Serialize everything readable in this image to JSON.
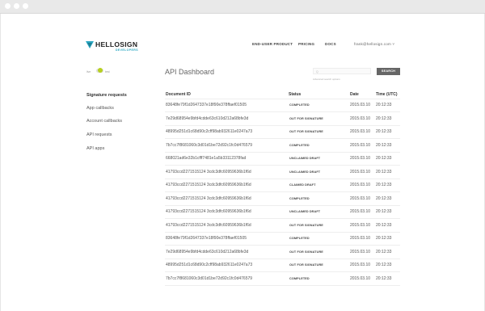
{
  "brand": {
    "name": "HELLOSIGN",
    "sub": "DEVELOPERS"
  },
  "nav": {
    "items": [
      "END-USER PRODUCT",
      "PRICING",
      "DOCS"
    ],
    "email": "frank@hellosign.com ˅"
  },
  "mode": {
    "left": "live",
    "right": "test"
  },
  "sidebar": {
    "heading": "Signature requests",
    "items": [
      "App callbacks",
      "Account callbacks",
      "API requests",
      "API apps"
    ]
  },
  "main": {
    "title": "API Dashboard",
    "search_placeholder": "Q",
    "search_hint": "Advanced search options",
    "search_button": "SEARCH"
  },
  "table": {
    "headers": [
      "Document ID",
      "Status",
      "Date",
      "Time (UTC)"
    ],
    "rows": [
      {
        "id": "83648fe79f1d2647337e18f90e378ffaef01505",
        "status": "COMPLETED",
        "date": "2015.03.10",
        "time": "20:12:33"
      },
      {
        "id": "7e29d68954e9bfd4cdde63c610d212a68bfe3d",
        "status": "OUT FOR SIGNATURE",
        "date": "2015.03.10",
        "time": "20:12:33"
      },
      {
        "id": "48995d251d1c68d90c2cff98ab932611e0247a73",
        "status": "OUT FOR SIGNATURE",
        "date": "2015.03.10",
        "time": "20:12:33"
      },
      {
        "id": "7b7cc7f8681060c3d01d1be72d92c1fc0d476579",
        "status": "COMPLETED",
        "date": "2015.03.10",
        "time": "20:12:33"
      },
      {
        "id": "668021ad6e32b1cfff7481e1a5b33112378fad",
        "status": "UNCLAIMED DRAFT",
        "date": "2015.03.10",
        "time": "20:12:33"
      },
      {
        "id": "41793ccd2271515124 3cdc3dfc60959636b1f6d",
        "status": "UNCLAIMED DRAFT",
        "date": "2015.03.10",
        "time": "20:12:33"
      },
      {
        "id": "41793ccd2271515124 3cdc3dfc60959636b1f6d",
        "status": "CLAIMED DRAFT",
        "date": "2015.03.10",
        "time": "20:12:33"
      },
      {
        "id": "41793ccd2271515124 3cdc3dfc60959636b1f6d",
        "status": "COMPLETED",
        "date": "2015.03.10",
        "time": "20:12:33"
      },
      {
        "id": "41793ccd2271515124 3cdc3dfc60959636b1f6d",
        "status": "UNCLAIMED DRAFT",
        "date": "2015.03.10",
        "time": "20:12:33"
      },
      {
        "id": "41793ccd2271515124 3cdc3dfc60959636b1f6d",
        "status": "OUT FOR SIGNATURE",
        "date": "2015.03.10",
        "time": "20:12:33"
      },
      {
        "id": "83648fe79f1d2647337e18f90e378ffaef01505",
        "status": "COMPLETED",
        "date": "2015.03.10",
        "time": "20:12:33"
      },
      {
        "id": "7e29d68954e9bfd4cdde63c610d212a68bfe3d",
        "status": "OUT FOR SIGNATURE",
        "date": "2015.03.10",
        "time": "20:12:33"
      },
      {
        "id": "48995d251d1c68d90c2cff98ab932611e0247a73",
        "status": "OUT FOR SIGNATURE",
        "date": "2015.03.10",
        "time": "20:12:33"
      },
      {
        "id": "7b7cc7f8681060c3d01d1be72d92c1fc0d476579",
        "status": "COMPLETED",
        "date": "2015.03.10",
        "time": "20:12:33"
      }
    ]
  },
  "colors": {
    "accent": "#2aa7c2",
    "toggle": "#b7d01f",
    "button": "#666666"
  }
}
